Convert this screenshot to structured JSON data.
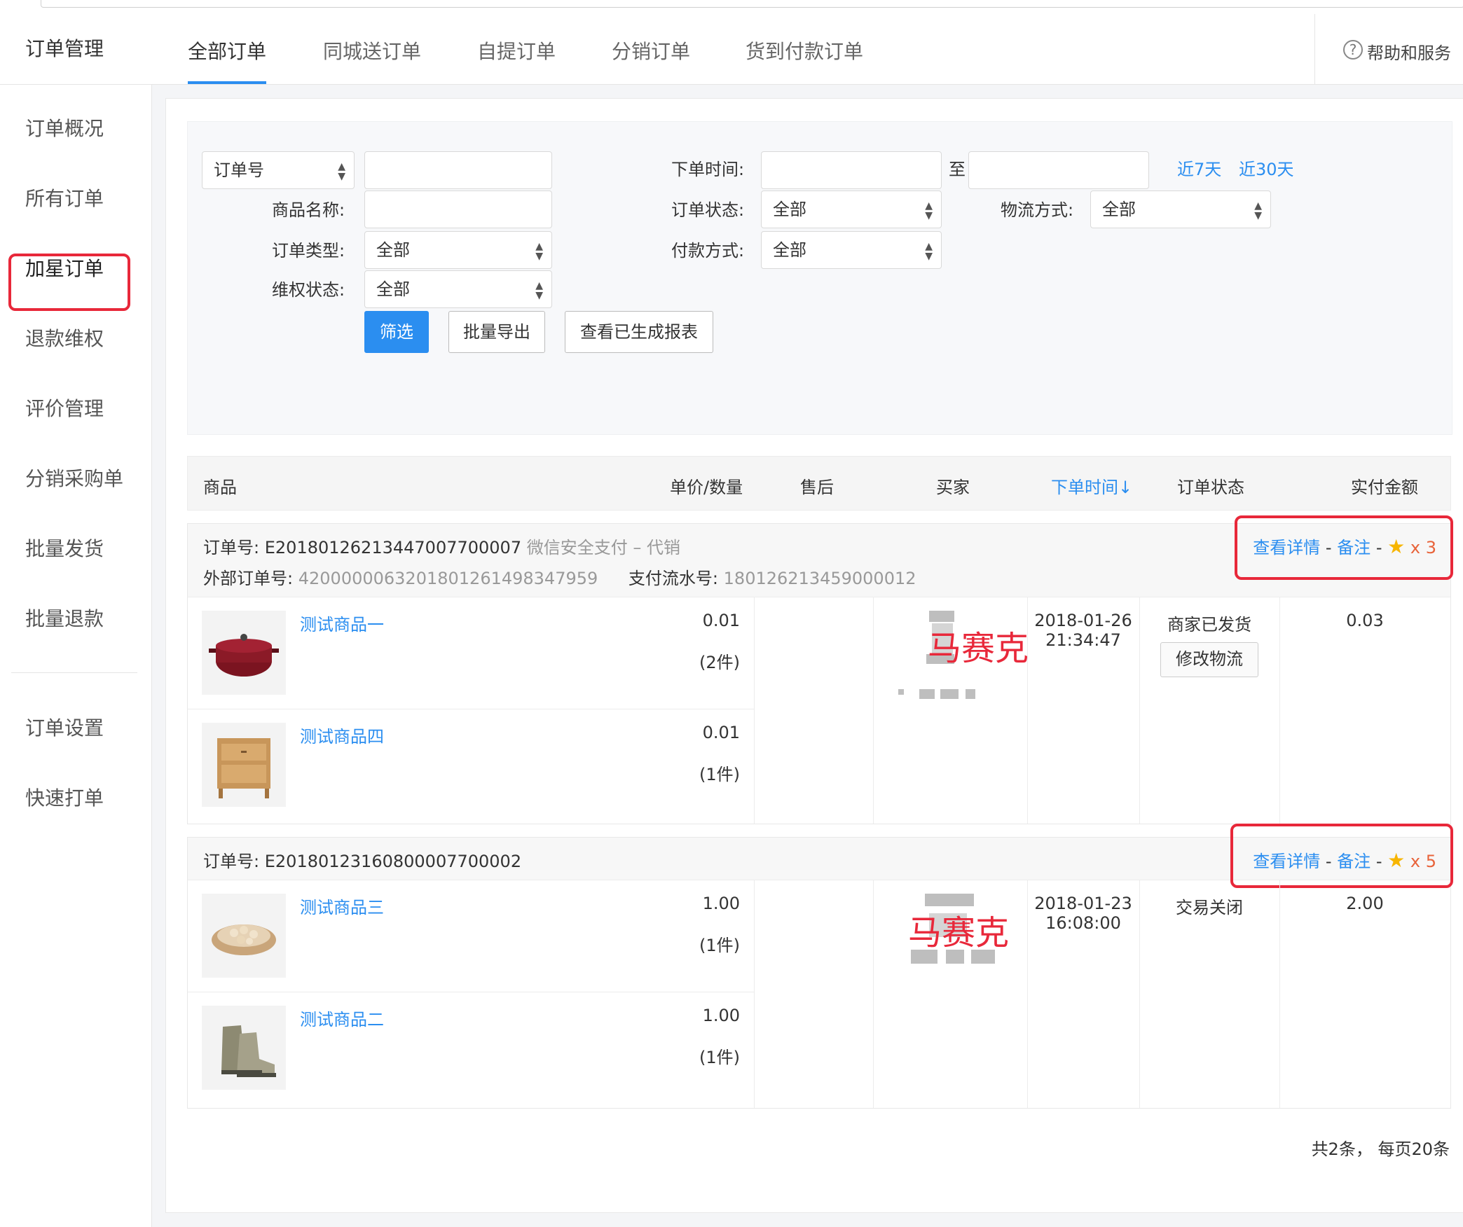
{
  "sidebar": {
    "title": "订单管理",
    "items": [
      {
        "label": "订单概况"
      },
      {
        "label": "所有订单"
      },
      {
        "label": "加星订单"
      },
      {
        "label": "退款维权"
      },
      {
        "label": "评价管理"
      },
      {
        "label": "分销采购单"
      },
      {
        "label": "批量发货"
      },
      {
        "label": "批量退款"
      },
      {
        "label": "订单设置"
      },
      {
        "label": "快速打单"
      }
    ]
  },
  "tabs": [
    {
      "label": "全部订单"
    },
    {
      "label": "同城送订单"
    },
    {
      "label": "自提订单"
    },
    {
      "label": "分销订单"
    },
    {
      "label": "货到付款订单"
    }
  ],
  "help": {
    "icon": "?",
    "label": "帮助和服务"
  },
  "filter": {
    "order_no_select": "订单号",
    "order_no_value": "",
    "product_name_label": "商品名称:",
    "order_type_label": "订单类型:",
    "order_type_value": "全部",
    "rights_label": "维权状态:",
    "rights_value": "全部",
    "order_time_label": "下单时间:",
    "to_label": "至",
    "quick_7": "近7天",
    "quick_30": "近30天",
    "order_status_label": "订单状态:",
    "order_status_value": "全部",
    "logistics_label": "物流方式:",
    "logistics_value": "全部",
    "payment_label": "付款方式:",
    "payment_value": "全部",
    "btn_filter": "筛选",
    "btn_export": "批量导出",
    "btn_reports": "查看已生成报表"
  },
  "table": {
    "headers": {
      "product": "商品",
      "price_qty": "单价/数量",
      "after_sale": "售后",
      "buyer": "买家",
      "order_time": "下单时间↓",
      "status": "订单状态",
      "paid": "实付金额"
    }
  },
  "orders": [
    {
      "order_no_label": "订单号:",
      "order_no": "E20180126213447007700007",
      "pay_note": "微信安全支付 – 代销",
      "ext_label": "外部订单号:",
      "ext_no": "4200000063201801261498347959",
      "flow_label": "支付流水号:",
      "flow_no": "180126213459000012",
      "op_detail": "查看详情",
      "op_sep": "-",
      "op_note": "备注",
      "star_count": "x 3",
      "items": [
        {
          "name": "测试商品一",
          "price": "0.01",
          "qty": "(2件)"
        },
        {
          "name": "测试商品四",
          "price": "0.01",
          "qty": "(1件)"
        }
      ],
      "buyer_mark": "马赛克",
      "date": "2018-01-26",
      "time": "21:34:47",
      "status": "商家已发货",
      "status_btn": "修改物流",
      "paid": "0.03"
    },
    {
      "order_no_label": "订单号:",
      "order_no": "E20180123160800007700002",
      "op_detail": "查看详情",
      "op_sep": "-",
      "op_note": "备注",
      "star_count": "x 5",
      "items": [
        {
          "name": "测试商品三",
          "price": "1.00",
          "qty": "(1件)"
        },
        {
          "name": "测试商品二",
          "price": "1.00",
          "qty": "(1件)"
        }
      ],
      "buyer_mark": "马赛克",
      "date": "2018-01-23",
      "time": "16:08:00",
      "status": "交易关闭",
      "paid": "2.00"
    }
  ],
  "pager": {
    "text": "共2条， 每页20条"
  },
  "colors": {
    "accent": "#2b8ef0",
    "highlight": "#e8283a",
    "star": "#f7b500"
  }
}
